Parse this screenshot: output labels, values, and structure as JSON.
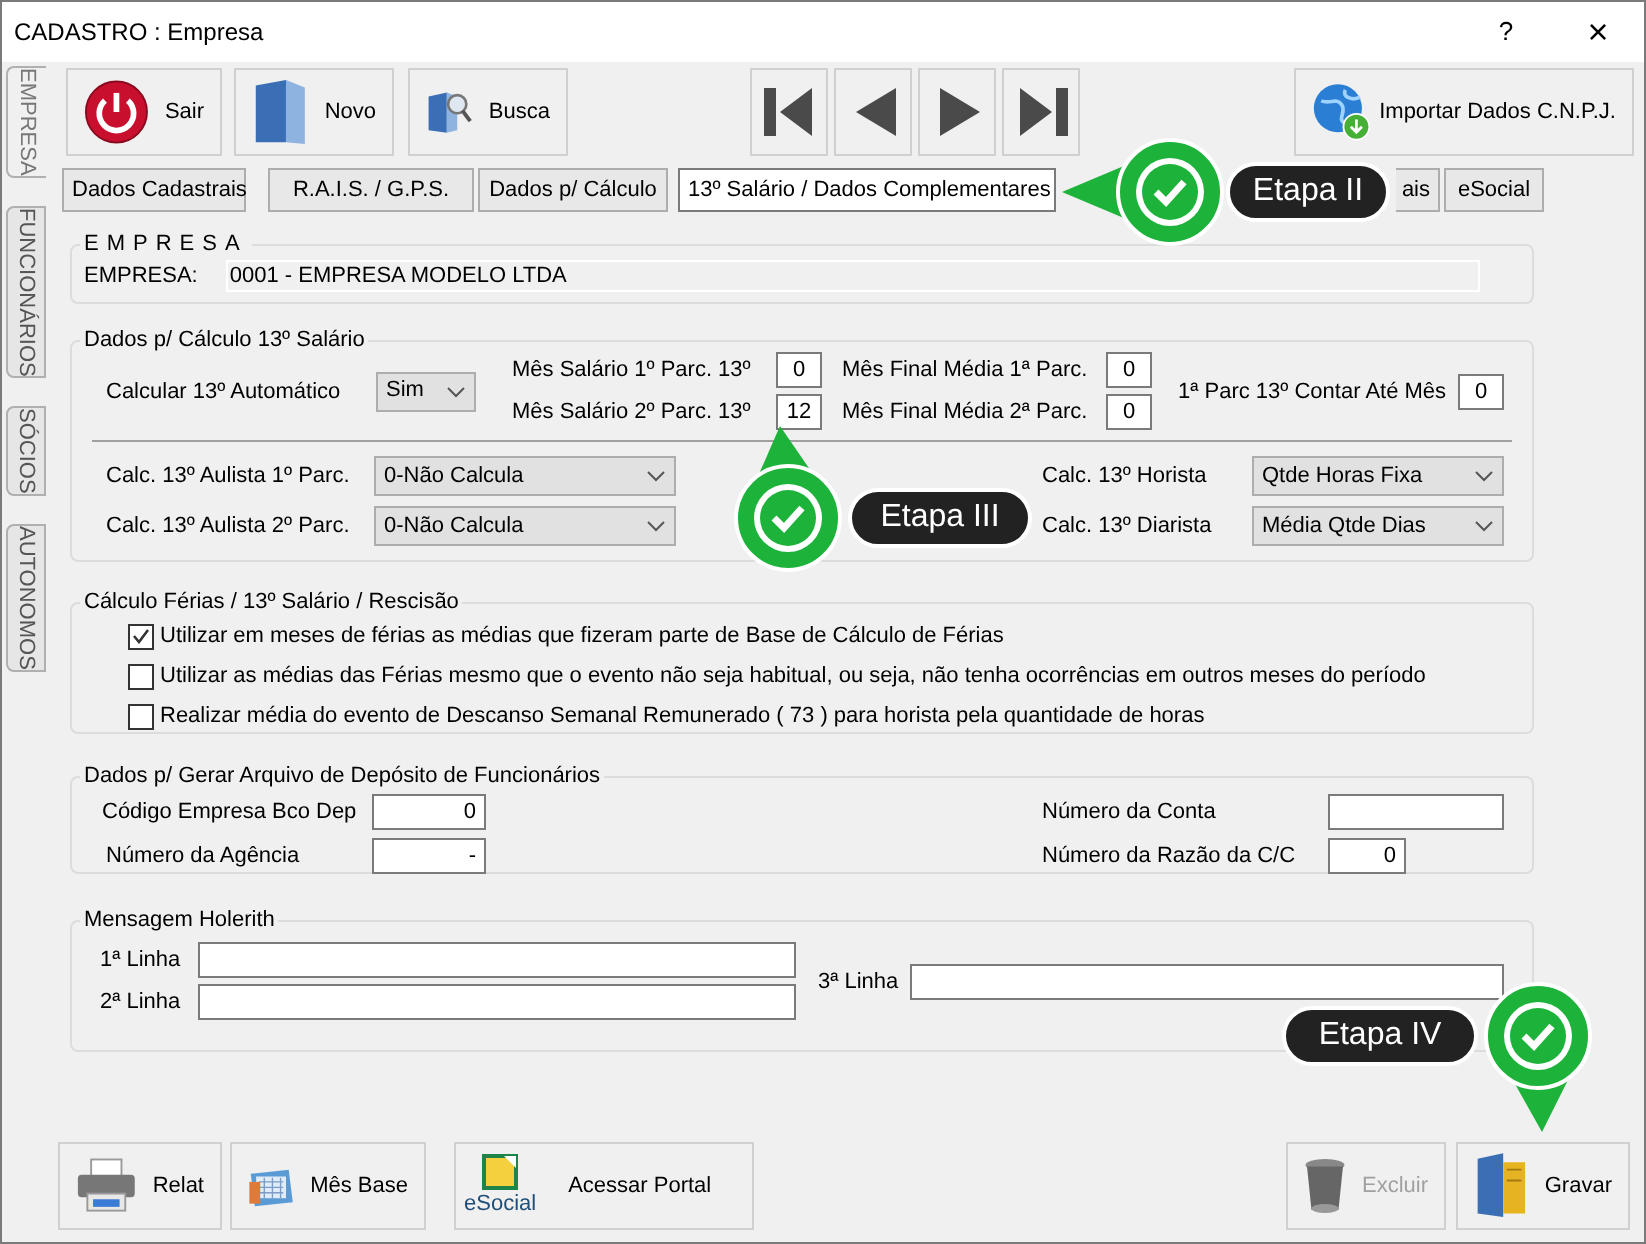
{
  "window": {
    "title": "CADASTRO : Empresa",
    "help": "?",
    "close": "×"
  },
  "side_tabs": [
    {
      "label": "EMPRESA",
      "selected": true
    },
    {
      "label": "FUNCIONÁRIOS",
      "selected": false
    },
    {
      "label": "SÓCIOS",
      "selected": false
    },
    {
      "label": "AUTONOMOS",
      "selected": false
    }
  ],
  "toolbar": [
    {
      "label": "Sair",
      "kind": "power"
    },
    {
      "label": "Novo",
      "kind": "book"
    },
    {
      "label": "Busca",
      "kind": "search"
    }
  ],
  "nav_buttons": [
    {
      "kind": "first"
    },
    {
      "kind": "prev"
    },
    {
      "kind": "next"
    },
    {
      "kind": "last"
    }
  ],
  "import_button": {
    "label": "Importar Dados C.N.P.J."
  },
  "tabs": [
    {
      "label": "Dados Cadastrais",
      "selected": false
    },
    {
      "label": "R.A.I.S. / G.P.S.",
      "selected": false
    },
    {
      "label": "Dados p/ Cálculo",
      "selected": false
    },
    {
      "label": "13º Salário / Dados Complementares",
      "selected": true
    },
    {
      "label": "ais",
      "selected": false
    },
    {
      "label": "eSocial",
      "selected": false
    }
  ],
  "empresa": {
    "title": "EMPRESA",
    "label": "EMPRESA:",
    "value": "0001 - EMPRESA MODELO LTDA"
  },
  "calculo": {
    "title": "Dados p/ Cálculo 13º Salário",
    "auto": {
      "label": "Calcular 13º Automático",
      "value": "Sim"
    },
    "mes_salario": [
      {
        "label": "Mês Salário 1º Parc. 13º",
        "value": "0"
      },
      {
        "label": "Mês Salário 2º Parc. 13º",
        "value": "12"
      }
    ],
    "mes_final": [
      {
        "label": "Mês Final Média 1ª Parc.",
        "value": "0"
      },
      {
        "label": "Mês Final Média 2ª Parc.",
        "value": "0"
      }
    ],
    "contar": {
      "label": "1ª Parc 13º Contar Até Mês",
      "value": "0"
    },
    "aulista": [
      {
        "label": "Calc. 13º Aulista 1º Parc.",
        "value": "0-Não Calcula"
      },
      {
        "label": "Calc. 13º Aulista 2º Parc.",
        "value": "0-Não Calcula"
      }
    ],
    "outros": [
      {
        "label": "Calc. 13º Horista",
        "value": "Qtde Horas Fixa"
      },
      {
        "label": "Calc. 13º Diarista",
        "value": "Média Qtde Dias"
      }
    ]
  },
  "ferias": {
    "title": "Cálculo Férias / 13º Salário / Rescisão",
    "options": [
      {
        "label": "Utilizar em meses de férias as médias que fizeram parte de Base de Cálculo de Férias",
        "checked": true
      },
      {
        "label": "Utilizar as médias das Férias mesmo que o evento não seja habitual, ou seja, não tenha ocorrências em outros meses do período",
        "checked": false
      },
      {
        "label": "Realizar média do evento de Descanso Semanal Remunerado ( 73 ) para horista pela quantidade de horas",
        "checked": false
      }
    ]
  },
  "deposito": {
    "title": "Dados p/ Gerar Arquivo de Depósito de Funcionários",
    "left": [
      {
        "label": "Código Empresa Bco Dep",
        "value": "0"
      },
      {
        "label": "Número da Agência",
        "value": "-"
      }
    ],
    "conta": {
      "label": "Número da Conta"
    },
    "razao": {
      "label": "Número da Razão da C/C",
      "value": "0"
    }
  },
  "holerith": {
    "title": "Mensagem Holerith",
    "lines": [
      {
        "label": "1ª Linha"
      },
      {
        "label": "2ª Linha"
      },
      {
        "label": "3ª Linha"
      }
    ]
  },
  "bottom_left": [
    {
      "label": "Relat",
      "kind": "printer",
      "disabled": false
    },
    {
      "label": "Mês Base",
      "kind": "calendar",
      "disabled": false
    }
  ],
  "portal": {
    "logo": "eSocial",
    "label": "Acessar Portal"
  },
  "bottom_right": [
    {
      "label": "Excluir",
      "kind": "trash",
      "disabled": true
    },
    {
      "label": "Gravar",
      "kind": "folder",
      "disabled": false
    }
  ],
  "callouts": [
    {
      "label": "Etapa II"
    },
    {
      "label": "Etapa III"
    },
    {
      "label": "Etapa IV"
    }
  ]
}
